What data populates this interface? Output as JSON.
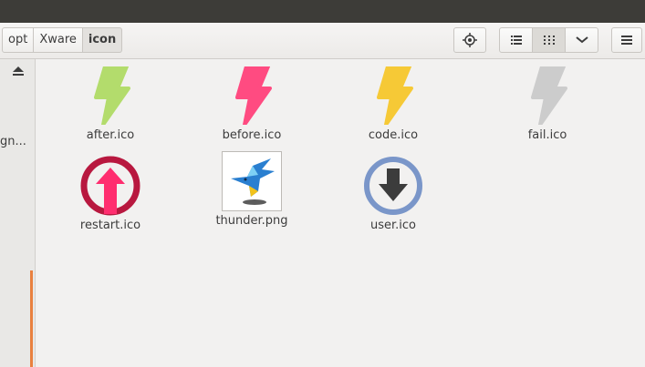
{
  "pathbar": {
    "crumbs": [
      "opt",
      "Xware",
      "icon"
    ]
  },
  "toolbar": {
    "location_icon": "crosshair-icon",
    "list_view_icon": "list-icon",
    "grid_view_icon": "grid-icon",
    "dropdown_icon": "chevron-down-icon",
    "menu_icon": "hamburger-icon"
  },
  "sidebar": {
    "truncated_item": "gn..."
  },
  "files": [
    {
      "name": "after.ico",
      "icon": "lightning-bolt-icon",
      "color": "#b3dc6c"
    },
    {
      "name": "before.ico",
      "icon": "lightning-bolt-icon",
      "color": "#ff4b81"
    },
    {
      "name": "code.ico",
      "icon": "lightning-bolt-icon",
      "color": "#f6c936"
    },
    {
      "name": "fail.ico",
      "icon": "lightning-bolt-icon",
      "color": "#cccccc"
    },
    {
      "name": "restart.ico",
      "icon": "up-arrow-circle-icon",
      "color": "#b8183f"
    },
    {
      "name": "thunder.png",
      "icon": "hummingbird-thumbnail",
      "color": "#2a7fd0"
    },
    {
      "name": "user.ico",
      "icon": "down-arrow-circle-icon",
      "color": "#7a96c9"
    }
  ]
}
